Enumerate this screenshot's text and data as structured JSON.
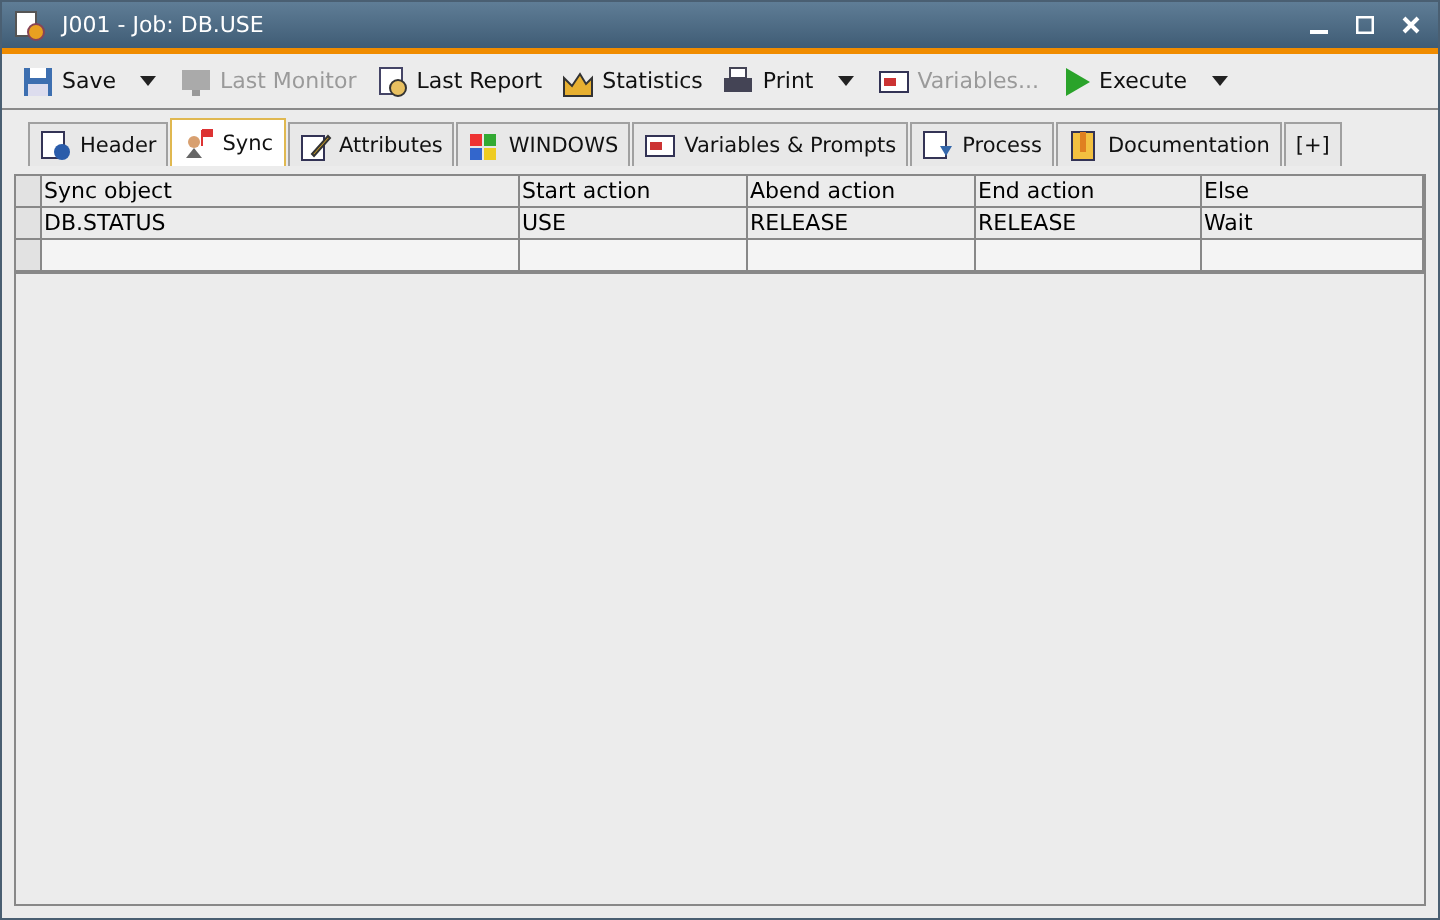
{
  "window": {
    "title": "J001 - Job: DB.USE"
  },
  "toolbar": [
    {
      "label": "Save",
      "disabled": false,
      "has_menu": true
    },
    {
      "label": "Last Monitor",
      "disabled": true,
      "has_menu": false
    },
    {
      "label": "Last Report",
      "disabled": false,
      "has_menu": false
    },
    {
      "label": "Statistics",
      "disabled": false,
      "has_menu": false
    },
    {
      "label": "Print",
      "disabled": false,
      "has_menu": true
    },
    {
      "label": "Variables...",
      "disabled": true,
      "has_menu": false
    },
    {
      "label": "Execute",
      "disabled": false,
      "has_menu": true
    }
  ],
  "tabs": [
    {
      "label": "Header",
      "selected": false
    },
    {
      "label": "Sync",
      "selected": true
    },
    {
      "label": "Attributes",
      "selected": false
    },
    {
      "label": "WINDOWS",
      "selected": false
    },
    {
      "label": "Variables & Prompts",
      "selected": false
    },
    {
      "label": "Process",
      "selected": false
    },
    {
      "label": "Documentation",
      "selected": false
    },
    {
      "label": "[+]",
      "selected": false
    }
  ],
  "table": {
    "columns": [
      "Sync object",
      "Start action",
      "Abend action",
      "End action",
      "Else"
    ],
    "rows": [
      [
        "DB.STATUS",
        "USE",
        "RELEASE",
        "RELEASE",
        "Wait"
      ]
    ]
  }
}
